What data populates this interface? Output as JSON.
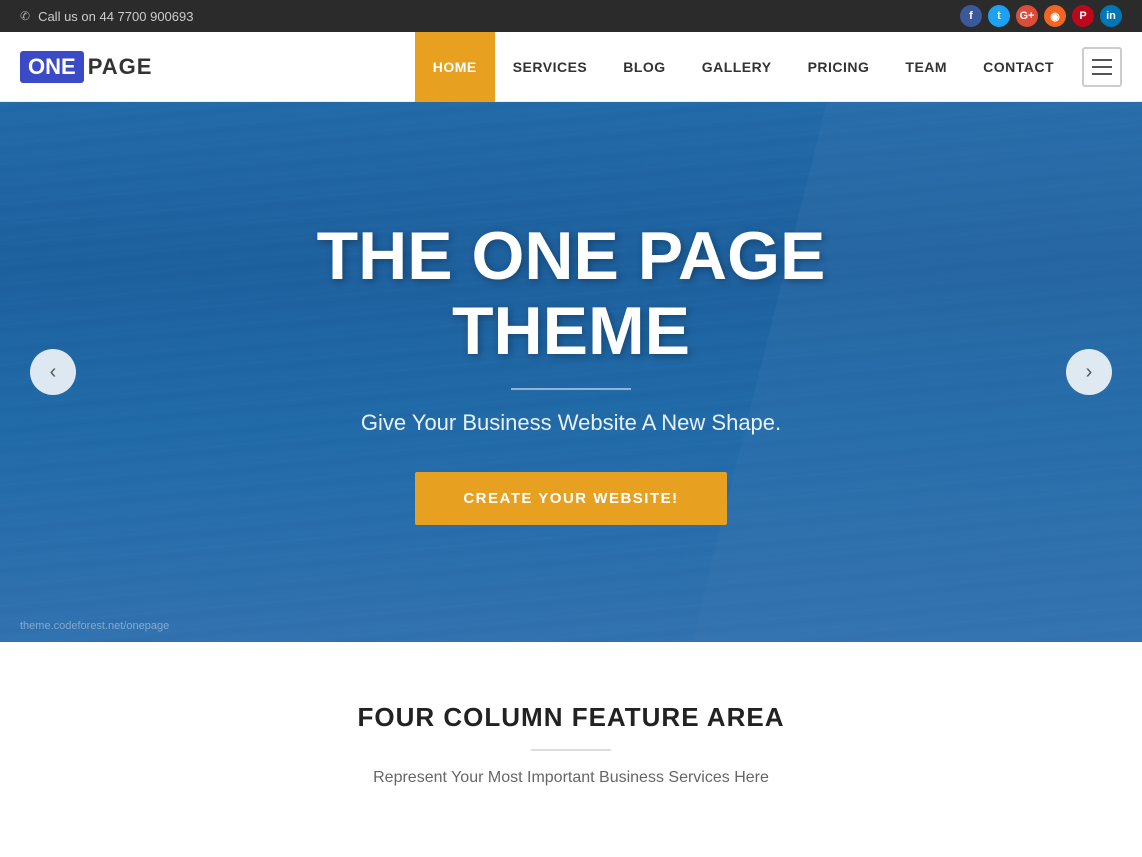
{
  "topbar": {
    "phone_text": "Call us on 44 7700 900693",
    "socials": [
      {
        "name": "facebook",
        "label": "f",
        "color_class": "social-facebook"
      },
      {
        "name": "twitter",
        "label": "t",
        "color_class": "social-twitter"
      },
      {
        "name": "google",
        "label": "G",
        "color_class": "social-google"
      },
      {
        "name": "rss",
        "label": "◉",
        "color_class": "social-rss"
      },
      {
        "name": "pinterest",
        "label": "P",
        "color_class": "social-pinterest"
      },
      {
        "name": "linkedin",
        "label": "in",
        "color_class": "social-linkedin"
      }
    ]
  },
  "header": {
    "logo_one": "ONE",
    "logo_page": "PAGE",
    "nav_items": [
      {
        "label": "HOME",
        "active": true
      },
      {
        "label": "SERVICES",
        "active": false
      },
      {
        "label": "BLOG",
        "active": false
      },
      {
        "label": "GALLERY",
        "active": false
      },
      {
        "label": "PRICING",
        "active": false
      },
      {
        "label": "TEAM",
        "active": false
      },
      {
        "label": "CONTACT",
        "active": false
      }
    ]
  },
  "hero": {
    "title": "THE ONE PAGE THEME",
    "subtitle": "Give Your Business Website A New Shape.",
    "cta_label": "CREATE YOUR WEBSITE!",
    "prev_arrow": "‹",
    "next_arrow": "›",
    "watermark": "theme.codeforest.net/onepage"
  },
  "features": {
    "title": "FOUR COLUMN FEATURE AREA",
    "subtitle": "Represent Your Most Important Business Services Here"
  }
}
